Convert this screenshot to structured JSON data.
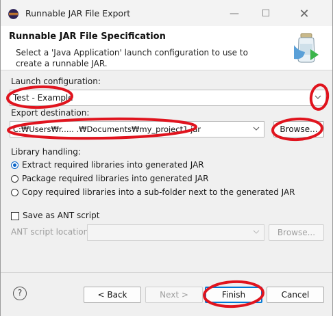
{
  "window": {
    "title": "Runnable JAR File Export",
    "minimize_glyph": "—",
    "maximize_glyph": "☐",
    "close_glyph": "✕"
  },
  "header": {
    "title": "Runnable JAR File Specification",
    "description": "Select a 'Java Application' launch configuration to use to create a runnable JAR."
  },
  "launch": {
    "label": "Launch configuration:",
    "value": "Test - Example"
  },
  "export": {
    "label": "Export destination:",
    "value": "C:₩Users₩r..... .₩Documents₩my_project1.jar",
    "browse_label": "Browse..."
  },
  "library": {
    "label": "Library handling:",
    "options": [
      {
        "label": "Extract required libraries into generated JAR",
        "checked": true
      },
      {
        "label": "Package required libraries into generated JAR",
        "checked": false
      },
      {
        "label": "Copy required libraries into a sub-folder next to the generated JAR",
        "checked": false
      }
    ]
  },
  "ant": {
    "checkbox_label": "Save as ANT script",
    "checked": false,
    "location_label": "ANT script location:",
    "location_value": "",
    "browse_label": "Browse..."
  },
  "footer": {
    "help_glyph": "?",
    "back_label": "< Back",
    "next_label": "Next >",
    "finish_label": "Finish",
    "cancel_label": "Cancel"
  },
  "icons": [
    "eclipse-icon",
    "jar-wizard-icon",
    "chevron-down-icon",
    "help-icon"
  ],
  "colors": {
    "accent": "#0078d4",
    "radio_selected": "#0a64c8",
    "annotation_red": "#e0141e"
  }
}
